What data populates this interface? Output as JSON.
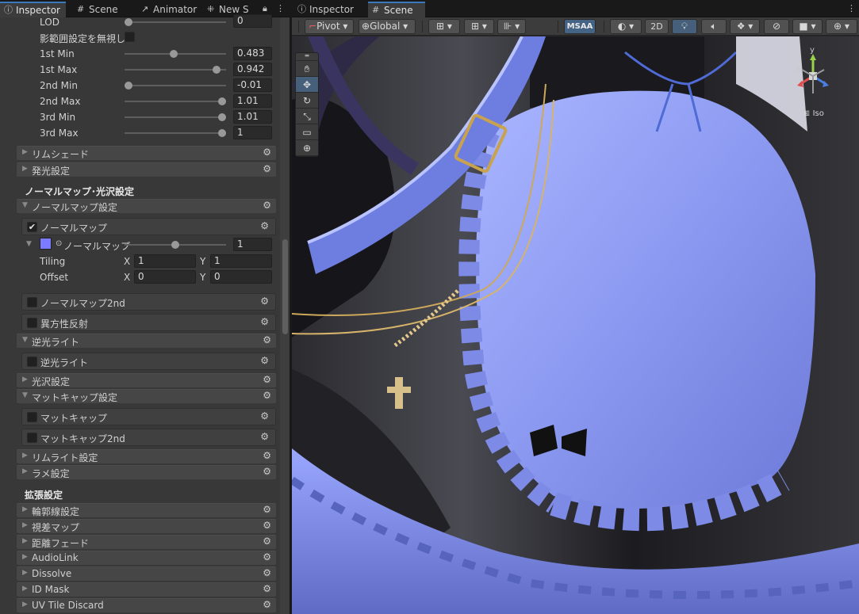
{
  "left_tabs": [
    {
      "label": "Inspector",
      "icon": "ⓘ"
    },
    {
      "label": "Scene",
      "icon": "#"
    },
    {
      "label": "Animator",
      "icon": "↗"
    },
    {
      "label": "New S",
      "icon": "⁜"
    }
  ],
  "right_tabs": [
    {
      "label": "Inspector",
      "icon": "ⓘ"
    },
    {
      "label": "Scene",
      "icon": "#"
    }
  ],
  "lod": {
    "label": "LOD",
    "value": "0",
    "level": 0
  },
  "ignore_shadow": {
    "label": "影範囲設定を無視し"
  },
  "sliders": [
    {
      "label": "1st Min",
      "value": "0.483",
      "level": 0.483
    },
    {
      "label": "1st Max",
      "value": "0.942",
      "level": 0.942
    },
    {
      "label": "2nd Min",
      "value": "-0.01",
      "level": 0.0
    },
    {
      "label": "2nd Max",
      "value": "1.01",
      "level": 1.0
    },
    {
      "label": "3rd Min",
      "value": "1.01",
      "level": 1.0
    },
    {
      "label": "3rd Max",
      "value": "1",
      "level": 1.0
    }
  ],
  "sections_top": [
    "リムシェード",
    "発光設定"
  ],
  "header_normal": "ノーマルマップ･光沢設定",
  "normal_map_settings": "ノーマルマップ設定",
  "normal_map_toggle": "ノーマルマップ",
  "normal_map_slot": {
    "label": "ノーマルマップ",
    "value": "1",
    "level": 0.5,
    "color": "#7b7bff"
  },
  "tiling": {
    "label": "Tiling",
    "x_label": "X",
    "x": "1",
    "y_label": "Y",
    "y": "1"
  },
  "offset": {
    "label": "Offset",
    "x_label": "X",
    "x": "0",
    "y_label": "Y",
    "y": "0"
  },
  "normal_map_2nd": "ノーマルマップ2nd",
  "anisotropy": "異方性反射",
  "backlight_section": "逆光ライト",
  "backlight_toggle": "逆光ライト",
  "gloss_section": "光沢設定",
  "matcap_section": "マットキャップ設定",
  "matcap_toggle": "マットキャップ",
  "matcap_2nd": "マットキャップ2nd",
  "rimlight_section": "リムライト設定",
  "glitter_section": "ラメ設定",
  "header_ext": "拡張設定",
  "ext_sections": [
    "輪郭線設定",
    "視差マップ",
    "距離フェード",
    "AudioLink",
    "Dissolve",
    "ID Mask",
    "UV Tile Discard"
  ],
  "scene_toolbar": {
    "pivot": "Pivot",
    "global": "Global",
    "msaa": "MSAA",
    "mode_2d": "2D"
  },
  "gizmo": {
    "persp_label": "Iso",
    "axis_y": "y",
    "axis_x": "x"
  },
  "colors": {
    "accent": "#3a79bb",
    "apron": "#8c9cff",
    "skirt": "#1f1f22"
  }
}
